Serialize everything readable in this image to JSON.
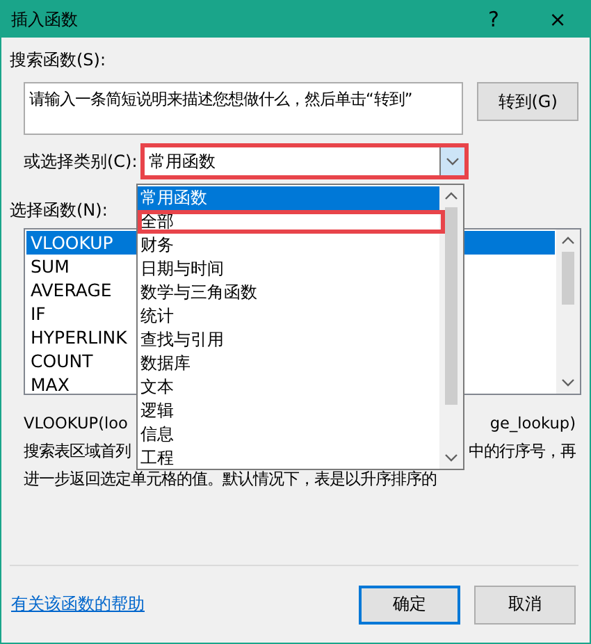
{
  "window": {
    "title": "插入函数",
    "help_button": "?",
    "close_button": "×"
  },
  "search": {
    "label": "搜索函数(S):",
    "placeholder": "请输入一条简短说明来描述您想做什么，然后单击“转到”",
    "go_button": "转到(G)"
  },
  "category": {
    "label": "或选择类别(C):",
    "value": "常用函数",
    "highlighted": true,
    "expanded": true,
    "options": [
      {
        "label": "常用函数",
        "selected": true,
        "highlighted": false
      },
      {
        "label": "全部",
        "selected": false,
        "highlighted": true
      },
      {
        "label": "财务",
        "selected": false,
        "highlighted": false
      },
      {
        "label": "日期与时间",
        "selected": false,
        "highlighted": false
      },
      {
        "label": "数学与三角函数",
        "selected": false,
        "highlighted": false
      },
      {
        "label": "统计",
        "selected": false,
        "highlighted": false
      },
      {
        "label": "查找与引用",
        "selected": false,
        "highlighted": false
      },
      {
        "label": "数据库",
        "selected": false,
        "highlighted": false
      },
      {
        "label": "文本",
        "selected": false,
        "highlighted": false
      },
      {
        "label": "逻辑",
        "selected": false,
        "highlighted": false
      },
      {
        "label": "信息",
        "selected": false,
        "highlighted": false
      },
      {
        "label": "工程",
        "selected": false,
        "highlighted": false
      }
    ]
  },
  "functions": {
    "label": "选择函数(N):",
    "items": [
      {
        "label": "VLOOKUP",
        "selected": true
      },
      {
        "label": "SUM",
        "selected": false
      },
      {
        "label": "AVERAGE",
        "selected": false
      },
      {
        "label": "IF",
        "selected": false
      },
      {
        "label": "HYPERLINK",
        "selected": false
      },
      {
        "label": "COUNT",
        "selected": false
      },
      {
        "label": "MAX",
        "selected": false
      }
    ]
  },
  "signature": [
    "VLOOKUP(loo",
    "ge_lookup)"
  ],
  "description": [
    [
      "搜索表区域首列",
      "中的行序号，再"
    ],
    [
      "进一步返回选定单元格的值。默认情况下，表是以升序排序的"
    ]
  ],
  "help_link": "有关该函数的帮助",
  "buttons": [
    "确定",
    "取消"
  ]
}
